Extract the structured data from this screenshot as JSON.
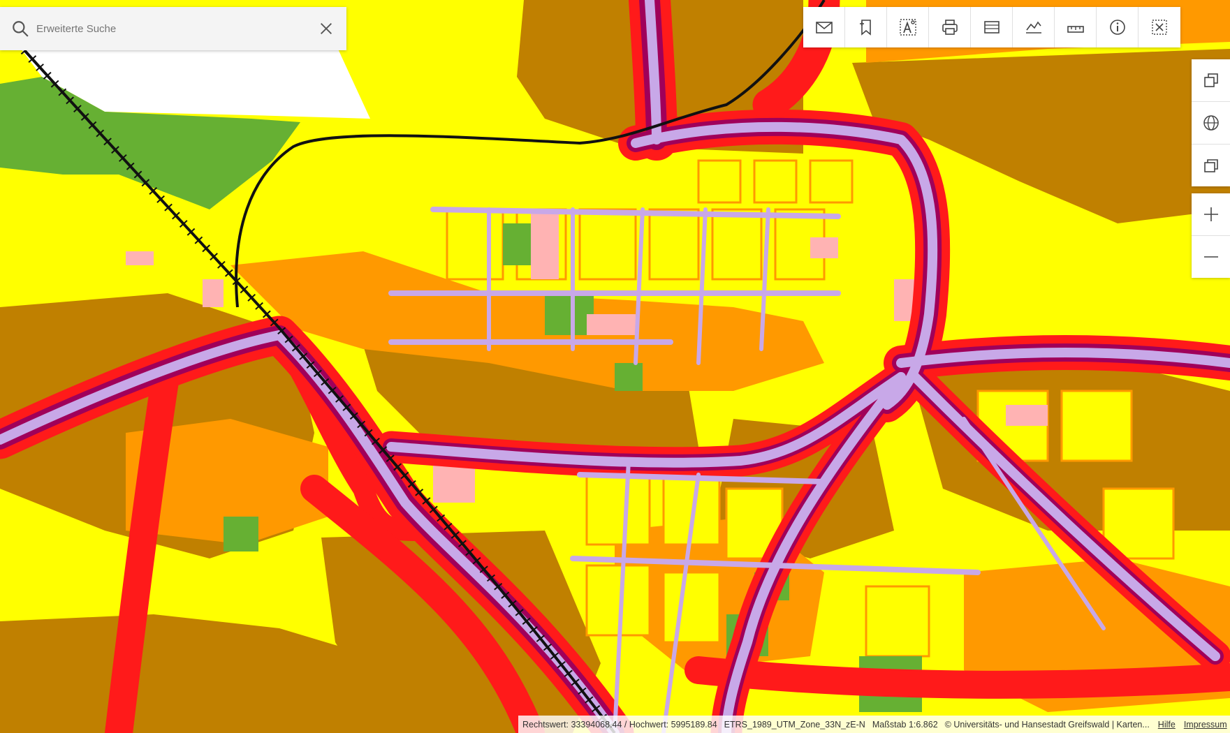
{
  "search": {
    "placeholder": "Erweiterte Suche"
  },
  "toolbar": {
    "tools": [
      {
        "name": "mail-icon"
      },
      {
        "name": "bookmark-icon"
      },
      {
        "name": "text-tool-icon"
      },
      {
        "name": "print-icon"
      },
      {
        "name": "measure-area-icon"
      },
      {
        "name": "elevation-profile-icon"
      },
      {
        "name": "measure-distance-icon"
      },
      {
        "name": "info-icon"
      },
      {
        "name": "clear-selection-icon"
      }
    ]
  },
  "sidebar": {
    "buttons": [
      {
        "name": "layers-icon"
      },
      {
        "name": "globe-icon"
      },
      {
        "name": "background-maps-icon"
      }
    ],
    "zoom": [
      {
        "name": "zoom-in-icon"
      },
      {
        "name": "zoom-out-icon"
      }
    ]
  },
  "footer": {
    "coordinates": "Rechtswert: 33394068.44 / Hochwert: 5995189.84",
    "crs": "ETRS_1989_UTM_Zone_33N_zE-N",
    "scale": "Maßstab 1:6.862",
    "copyright": "© Universitäts- und Hansestadt Greifswald | Karten...",
    "help_link": "Hilfe",
    "imprint_link": "Impressum"
  },
  "colors": {
    "quiet": "#ffff00",
    "moderate": "#ff9900",
    "loud": "#c08000",
    "very_loud": "#ff1a1a",
    "extreme": "#a0005a",
    "road": "#c8a8e8",
    "building": "#ffb3b3",
    "green": "#66b033"
  }
}
